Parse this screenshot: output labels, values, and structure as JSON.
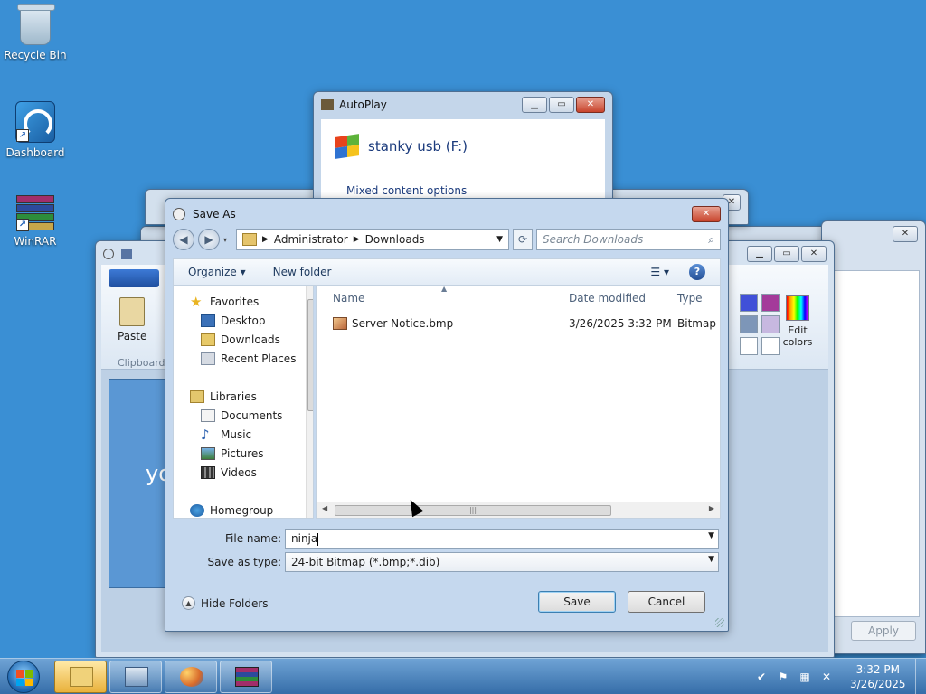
{
  "desktop": {
    "icons": [
      {
        "label": "Recycle Bin"
      },
      {
        "label": "Dashboard"
      },
      {
        "label": "WinRAR"
      }
    ]
  },
  "autoplay": {
    "title": "AutoPlay",
    "drive_label": "stanky usb (F:)",
    "section": "Mixed content options"
  },
  "paint": {
    "paste_label": "Paste",
    "clipboard_label": "Clipboard",
    "edit_colors_label": "Edit colors",
    "canvas_text": "yo"
  },
  "background_dialog": {
    "apply_label": "Apply"
  },
  "save_as": {
    "title": "Save As",
    "breadcrumb": [
      "Administrator",
      "Downloads"
    ],
    "search_placeholder": "Search Downloads",
    "toolbar": {
      "organize": "Organize",
      "new_folder": "New folder"
    },
    "nav": {
      "favorites": "Favorites",
      "desktop": "Desktop",
      "downloads": "Downloads",
      "recent_places": "Recent Places",
      "libraries": "Libraries",
      "documents": "Documents",
      "music": "Music",
      "pictures": "Pictures",
      "videos": "Videos",
      "homegroup": "Homegroup"
    },
    "columns": {
      "name": "Name",
      "date_modified": "Date modified",
      "type": "Type"
    },
    "files": [
      {
        "name": "Server Notice.bmp",
        "date_modified": "3/26/2025 3:32 PM",
        "type": "Bitmap in"
      }
    ],
    "file_name_label": "File name:",
    "file_name_value": "ninja",
    "save_type_label": "Save as type:",
    "save_type_value": "24-bit Bitmap (*.bmp;*.dib)",
    "hide_folders": "Hide Folders",
    "save_button": "Save",
    "cancel_button": "Cancel"
  },
  "taskbar": {
    "time": "3:32 PM",
    "date": "3/26/2025"
  }
}
